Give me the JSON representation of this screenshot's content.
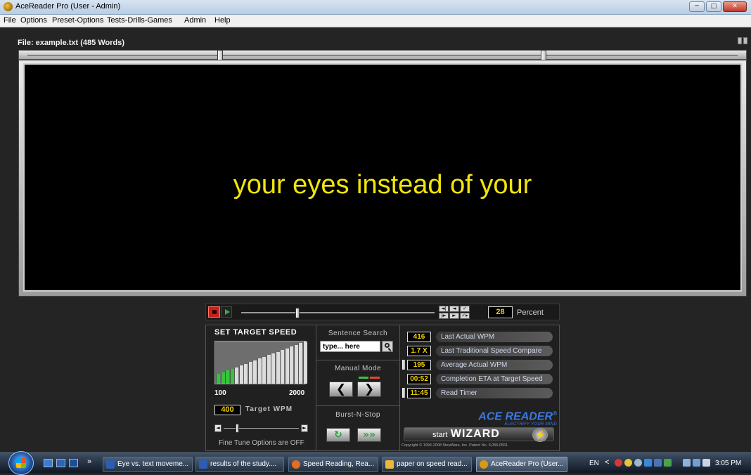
{
  "window": {
    "title": "AceReader Pro (User - Admin)",
    "controls": {
      "minimize": "─",
      "maximize": "□",
      "close": "✕"
    }
  },
  "menu": [
    "File",
    "Options",
    "Preset-Options",
    "Tests-Drills-Games",
    "Admin",
    "Help"
  ],
  "file_info": "File: example.txt (485 Words)",
  "display_text": "your eyes instead of your",
  "colors": {
    "display_text": "#f2e50a",
    "value_text": "#f0d000",
    "accent_green": "#35c43d",
    "brand_blue": "#3c78e0"
  },
  "controls": {
    "progress_percent": 28,
    "percent_value": "28",
    "percent_label": "Percent",
    "nav_buttons": [
      "◄|",
      "◄",
      "✓",
      "|►",
      "►",
      "✓▸"
    ]
  },
  "target_speed": {
    "title": "SET TARGET SPEED",
    "range_min": "100",
    "range_max": "2000",
    "target_value": "400",
    "target_label": "Target WPM",
    "fine_tune_status": "Fine Tune Options are OFF",
    "bars_total": 20,
    "bars_active": 4
  },
  "sentence_search": {
    "label": "Sentence Search",
    "input_value": "type... here"
  },
  "manual_mode": {
    "label": "Manual Mode",
    "prev_glyph": "❮",
    "next_glyph": "❯"
  },
  "burst_n_stop": {
    "label": "Burst-N-Stop",
    "repeat_glyph": "↻",
    "burst_glyph": "»»"
  },
  "stats": [
    {
      "value": "416",
      "label": "Last Actual WPM"
    },
    {
      "value": "1.7 X",
      "label": "Last Traditional Speed Compare"
    },
    {
      "value": "195",
      "label": "Average Actual WPM"
    },
    {
      "value": "00:52",
      "label": "Completion ETA at Target Speed"
    },
    {
      "value": "11:45",
      "label": "Read Timer"
    }
  ],
  "brand": {
    "name": "ACE READER",
    "registered": "®",
    "tagline": "ELECTRIFY YOUR MIND"
  },
  "wizard": {
    "small": "start",
    "big": "WIZARD",
    "bolt": "⚡"
  },
  "copyright": "Copyright © 1996-2008 StepWare, Inc. Patent No. 6,056,0551",
  "taskbar": {
    "buttons": [
      "Eye vs. text moveme...",
      "results  of the study....",
      "Speed Reading, Rea...",
      "paper on speed read...",
      "AceReader Pro (User..."
    ],
    "chevron": "»",
    "language": "EN",
    "tray_arrow": "<",
    "clock": "3:05 PM"
  }
}
